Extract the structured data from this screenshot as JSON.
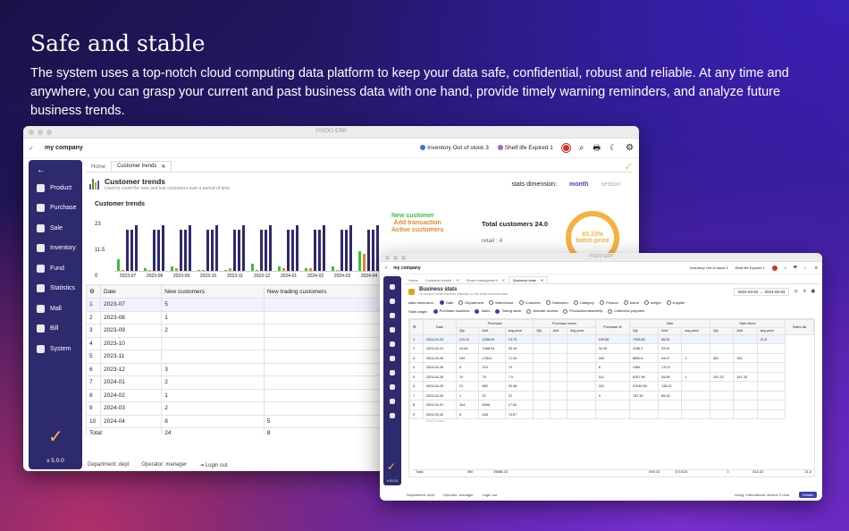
{
  "headline": "Safe and stable",
  "subtext": "The system uses a top-notch cloud computing data platform to keep your data safe, confidential, robust and reliable. At any time and anywhere, you can grasp your current and past business data with one hand, provide timely warning reminders, and analyze future business trends.",
  "win1": {
    "title": "YISOO ERP",
    "company": "my company",
    "alerts": {
      "stock": "Inventory Out of stock 3",
      "shelf": "Shelf life  Expired 1"
    },
    "sidebar": [
      "Product",
      "Purchase",
      "Sale",
      "Inventory",
      "Fund",
      "Statistics",
      "Mall",
      "Bill",
      "System"
    ],
    "version": "v 5.0.0",
    "tabs": [
      "Home",
      "Customer trends"
    ],
    "page_title": "Customer trends",
    "page_sub": "Used to count the new and lost customers over a period of time",
    "dim_label": "stats dimension:",
    "dim_month": "month",
    "dim_season": "season",
    "chart_title": "Customer trends",
    "legend": [
      "New customer",
      "Add transaction",
      "Active customers"
    ],
    "total_label": "Total customers 24.0",
    "retail": "retail : 4",
    "gauge": "83.33%",
    "gauge_sub": "batch price",
    "table": {
      "headers": [
        "Date",
        "New customers",
        "New trading customers",
        "Trading customers",
        "Silent customer"
      ],
      "rows": [
        [
          "1",
          "2023-07",
          "5",
          "",
          "",
          ""
        ],
        [
          "2",
          "2023-08",
          "1",
          "",
          "",
          "5"
        ],
        [
          "3",
          "2023-09",
          "2",
          "",
          "1",
          "5"
        ],
        [
          "4",
          "2023-10",
          "",
          "",
          "",
          "8"
        ],
        [
          "5",
          "2023-11",
          "",
          "",
          "1",
          "7"
        ],
        [
          "6",
          "2023-12",
          "3",
          "",
          "",
          "8"
        ],
        [
          "7",
          "2024-01",
          "2",
          "",
          "1",
          "10"
        ],
        [
          "8",
          "2024-02",
          "1",
          "",
          "1",
          "12"
        ],
        [
          "9",
          "2024-03",
          "2",
          "",
          "",
          "14"
        ],
        [
          "10",
          "2024-04",
          "8",
          "5",
          "7",
          "14"
        ]
      ],
      "total": [
        "Total:",
        "24",
        "8",
        "12",
        "106"
      ]
    },
    "footer": {
      "dept": "Department:  dept",
      "op": "Operator:  manager",
      "logout": "Login out"
    }
  },
  "chart_data": {
    "type": "bar",
    "title": "Customer trends",
    "categories": [
      "2023-07",
      "2023-08",
      "2023-09",
      "2023-10",
      "2023-11",
      "2023-12",
      "2024-01",
      "2024-02",
      "2024-03",
      "2024-04"
    ],
    "series": [
      {
        "name": "New customer",
        "values": [
          5,
          1,
          2,
          0,
          0,
          3,
          2,
          1,
          2,
          8
        ]
      },
      {
        "name": "Active customers",
        "values": [
          0,
          0,
          1,
          0,
          1,
          0,
          1,
          1,
          0,
          7
        ]
      }
    ],
    "yticks": [
      "23",
      "11.5",
      "0"
    ],
    "ylim": [
      0,
      23
    ]
  },
  "win2": {
    "title": "YISOO ERP",
    "company": "my company",
    "alerts": {
      "stock": "Inventory Out of stock 3",
      "shelf": "Shelf life  Expired 1"
    },
    "version": "v 5.0.0",
    "tabs": [
      "Home",
      "Customer trends",
      "Share management",
      "Business stats"
    ],
    "page_title": "Business stats",
    "page_sub": "To conduct comprehensive statistics on the entire business data",
    "date_from": "2024-04-02",
    "date_to": "2024-05-02",
    "dim_label": "stats dimension:",
    "dims": [
      "Date",
      "Department",
      "Warehouse",
      "Customer",
      "Salesman",
      "Category",
      "Product",
      "brand",
      "weight",
      "supplier"
    ],
    "target_label": "Stats target:",
    "targets": [
      "Purchase business",
      "Sales",
      "Taking stock",
      "Allocate access",
      "Production/assembly",
      "Collection payment"
    ],
    "headers": [
      "Date",
      "Purchase",
      "Purchase return",
      "Purchase di",
      "Sale",
      "Sale return",
      "Sales dis"
    ],
    "subheaders": [
      "Qty",
      "Amt",
      "avg price",
      "Qty",
      "Amt",
      "avg price",
      "Qty",
      "Amt",
      "avg price",
      "Qty",
      "Amt",
      "avg price"
    ],
    "rows": [
      [
        "1",
        "2024-04-23",
        "211.11",
        "1058.00",
        "13.79",
        "",
        "",
        "",
        "105.56",
        "7053.66",
        "66.81",
        "",
        "",
        "",
        "21.8"
      ],
      [
        "2",
        "2024-04-24",
        "44.68",
        "1468.04",
        "33.16",
        "",
        "",
        "",
        "34.45",
        "1168.2",
        "33.91",
        "",
        "",
        "",
        ""
      ],
      [
        "3",
        "2024-04-25",
        "249",
        "17814",
        "71.54",
        "",
        "",
        "",
        "160",
        "8650.8",
        "54.07",
        "2",
        "362",
        "181",
        ""
      ],
      [
        "4",
        "2024-04-26",
        "5",
        "210",
        "70",
        "",
        "",
        "",
        "8",
        "1364",
        "170.5",
        "",
        "",
        "",
        ""
      ],
      [
        "5",
        "2024-04-28",
        "10",
        "79",
        "7.9",
        "",
        "",
        "",
        "114",
        "6257.96",
        "54.89",
        "1",
        "151.33",
        "151.33",
        ""
      ],
      [
        "6",
        "2024-04-29",
        "21",
        "850",
        "40.48",
        "",
        "",
        "",
        "161",
        "21930.55",
        "136.21",
        "",
        "",
        "",
        ""
      ],
      [
        "7",
        "2024-04-30",
        "1",
        "22",
        "22",
        "",
        "",
        "",
        "9",
        "787.33",
        "85.26",
        "",
        "",
        "",
        ""
      ],
      [
        "8",
        "2024-05-01",
        "344",
        "6066",
        "17.63",
        "",
        "",
        "",
        "",
        "",
        "",
        "",
        "",
        "",
        ""
      ],
      [
        "9",
        "2024-05-02",
        "6",
        "448",
        "74.67",
        "",
        "",
        "",
        "",
        "",
        "",
        "",
        "",
        "",
        ""
      ]
    ],
    "rows_count": "Total 9 rows",
    "total": [
      "Total:",
      "",
      "690",
      "29886.15",
      "",
      "",
      "",
      "",
      "",
      "593.03",
      "47193.5",
      "",
      "3",
      "513.33",
      "",
      "21.8"
    ],
    "footer": {
      "dept": "Department:  dept",
      "op": "Operator:  manager",
      "logout": "Login out",
      "using": "Using:  International Version 3 User",
      "details": "Details"
    }
  }
}
